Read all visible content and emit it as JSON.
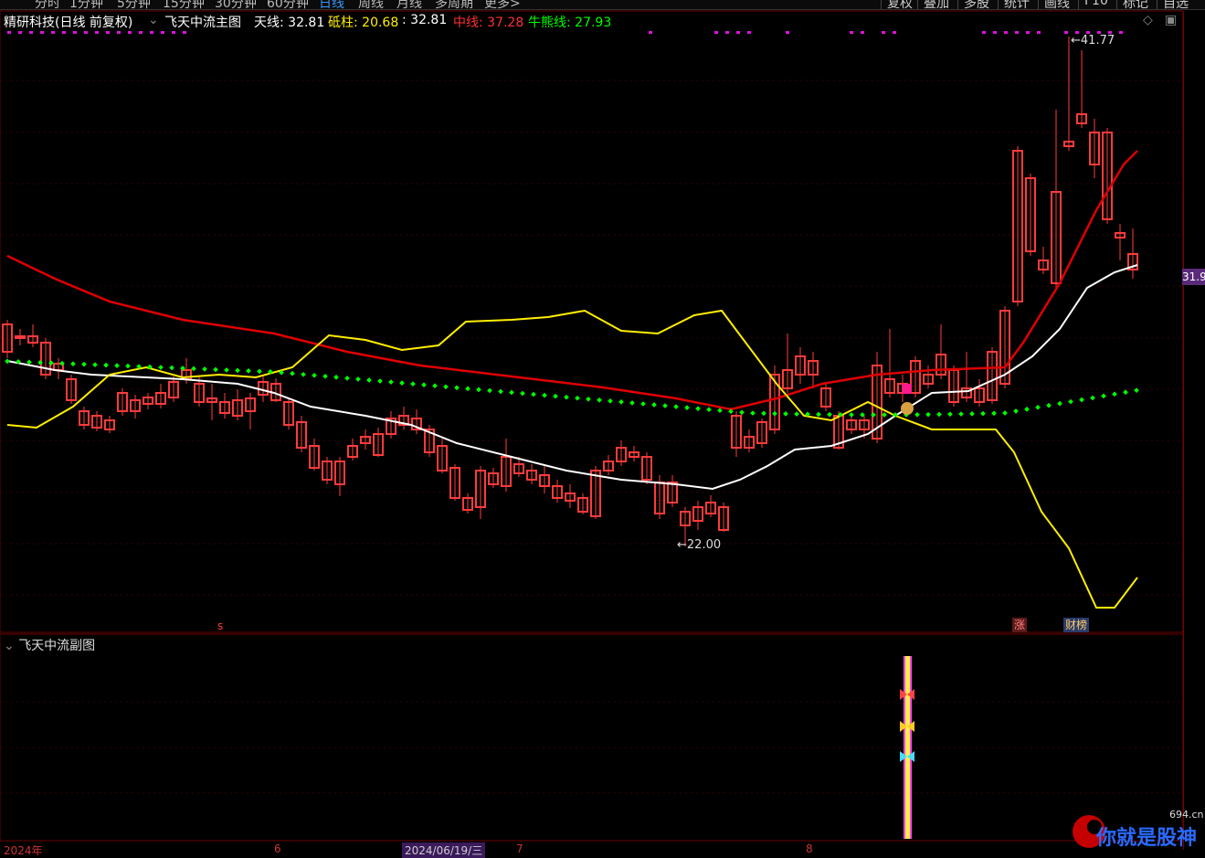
{
  "toolbar": {
    "periods": [
      "分时",
      "1分钟",
      "5分钟",
      "15分钟",
      "30分钟",
      "60分钟",
      "日线",
      "周线",
      "月线",
      "多周期",
      "更多>"
    ],
    "active_period": "日线",
    "buttons": [
      "复权",
      "叠加",
      "多股",
      "统计",
      "画线",
      "F10",
      "标记",
      "自选"
    ]
  },
  "header": {
    "stock": "精研科技(日线 前复权)",
    "indicator": "飞天中流主图",
    "tianxian_label": "天线: 32.81",
    "dizhu_label": "砥柱: 20.68",
    "dizhu_value2": ": 32.81",
    "zhongxian_label": "中线: 37.28",
    "niuxiong_label": "牛熊线: 27.93"
  },
  "chart": {
    "high_label": "41.77",
    "low_label": "22.00",
    "current_price": "31.9",
    "marker_zhang": "涨",
    "marker_cai": "财榜",
    "marker_s": "s"
  },
  "sub": {
    "title": "飞天中流副图"
  },
  "footer": {
    "year_label": "2024年",
    "date_label": "2024/06/19/三",
    "mid_tick": "6",
    "mid_tick2": "7",
    "mid_tick3": "8"
  },
  "watermark": {
    "text": "你就是股神",
    "url": "694.cn"
  },
  "colors": {
    "up": "#ff3b3b",
    "down": "#00e5ff",
    "ma_white": "#ffffff",
    "ma_red": "#e00000",
    "ma_yellow": "#ffee00",
    "dots_green": "#00ff00"
  }
}
